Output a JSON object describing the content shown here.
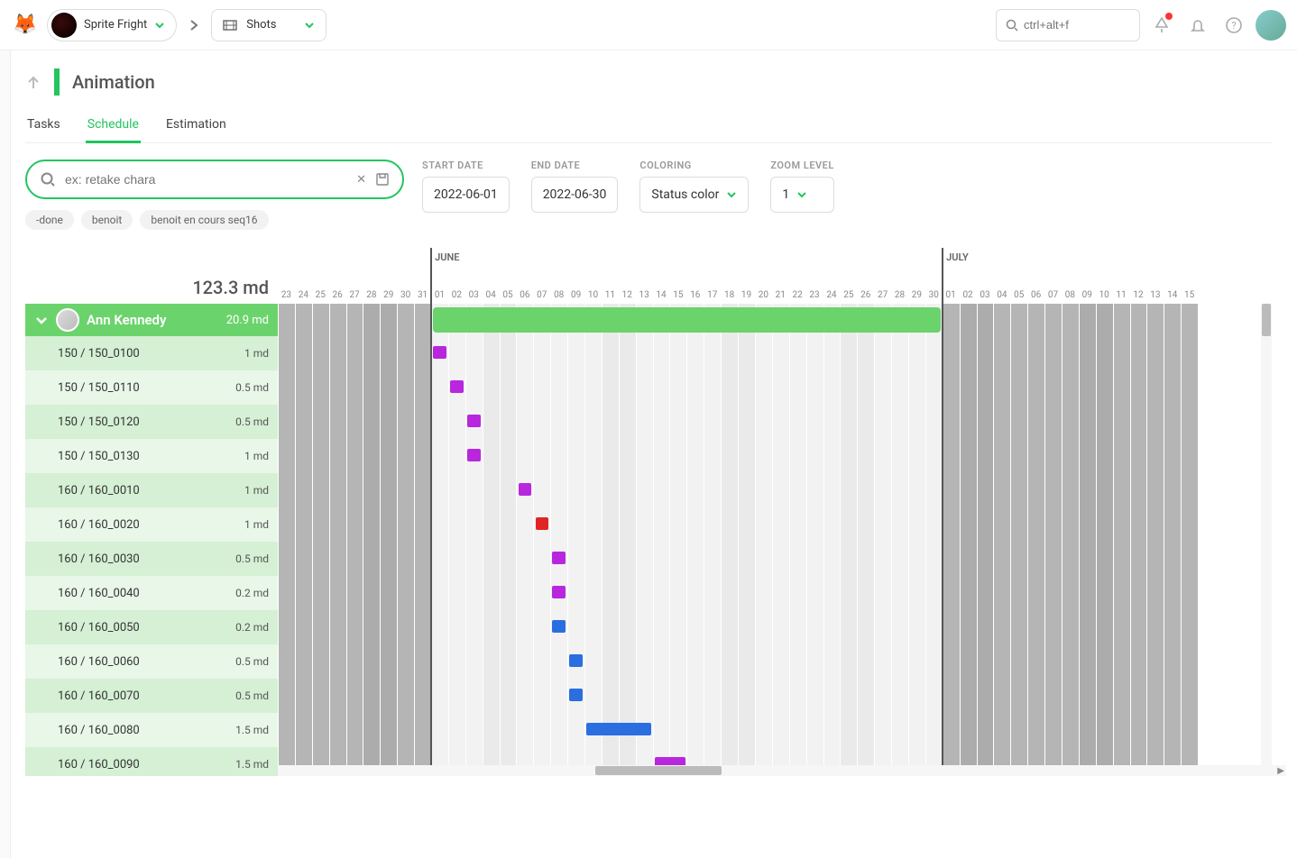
{
  "app": {
    "project_name": "Sprite Fright",
    "context_name": "Shots",
    "search_shortcut": "ctrl+alt+f"
  },
  "page": {
    "title": "Animation",
    "tabs": [
      "Tasks",
      "Schedule",
      "Estimation"
    ],
    "active_tab": 1
  },
  "search": {
    "placeholder": "ex: retake chara",
    "chips": [
      "-done",
      "benoit",
      "benoit en cours seq16"
    ]
  },
  "controls": {
    "start_date_label": "START DATE",
    "start_date": "2022-06-01",
    "end_date_label": "END DATE",
    "end_date": "2022-06-30",
    "coloring_label": "COLORING",
    "coloring_value": "Status color",
    "zoom_label": "ZOOM LEVEL",
    "zoom_value": "1"
  },
  "colors": {
    "accent": "#22c55e",
    "purple": "#b827dd",
    "red": "#e02424",
    "blue": "#2b6ee0",
    "artist_row": "#6bd36b"
  },
  "timeline": {
    "total_md": "123.3 md",
    "may_start_day": 23,
    "may_end_day": 31,
    "june_days": 30,
    "july_days_shown": 15,
    "months": [
      {
        "label": "JUNE",
        "day_index": 9
      },
      {
        "label": "JULY",
        "day_index": 39
      }
    ]
  },
  "artist": {
    "name": "Ann Kennedy",
    "md": "20.9 md",
    "bar_start_col": 9,
    "bar_span_cols": 30
  },
  "tasks": [
    {
      "name": "150 / 150_0100",
      "md": "1 md",
      "start": 9,
      "span": 1,
      "color": "purple"
    },
    {
      "name": "150 / 150_0110",
      "md": "0.5 md",
      "start": 10,
      "span": 1,
      "color": "purple"
    },
    {
      "name": "150 / 150_0120",
      "md": "0.5 md",
      "start": 11,
      "span": 1,
      "color": "purple"
    },
    {
      "name": "150 / 150_0130",
      "md": "1 md",
      "start": 11,
      "span": 1,
      "color": "purple"
    },
    {
      "name": "160 / 160_0010",
      "md": "1 md",
      "start": 14,
      "span": 1,
      "color": "purple"
    },
    {
      "name": "160 / 160_0020",
      "md": "1 md",
      "start": 15,
      "span": 1,
      "color": "red"
    },
    {
      "name": "160 / 160_0030",
      "md": "0.5 md",
      "start": 16,
      "span": 1,
      "color": "purple"
    },
    {
      "name": "160 / 160_0040",
      "md": "0.2 md",
      "start": 16,
      "span": 1,
      "color": "purple"
    },
    {
      "name": "160 / 160_0050",
      "md": "0.2 md",
      "start": 16,
      "span": 1,
      "color": "blue"
    },
    {
      "name": "160 / 160_0060",
      "md": "0.5 md",
      "start": 17,
      "span": 1,
      "color": "blue"
    },
    {
      "name": "160 / 160_0070",
      "md": "0.5 md",
      "start": 17,
      "span": 1,
      "color": "blue"
    },
    {
      "name": "160 / 160_0080",
      "md": "1.5 md",
      "start": 18,
      "span": 4,
      "color": "blue"
    },
    {
      "name": "160 / 160_0090",
      "md": "1.5 md",
      "start": 22,
      "span": 2,
      "color": "purple"
    }
  ]
}
